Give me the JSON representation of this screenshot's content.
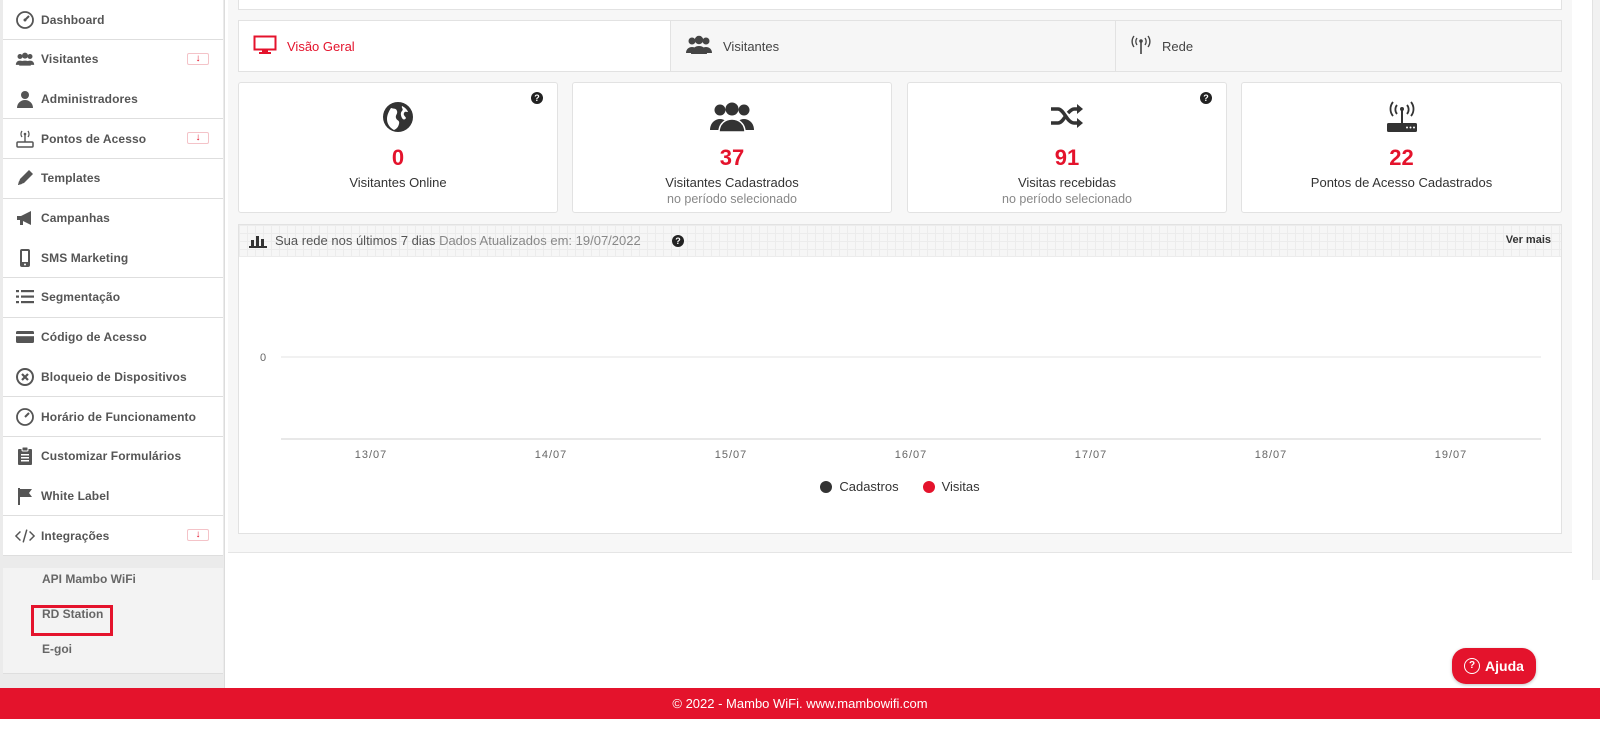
{
  "sidebar": {
    "items": [
      {
        "label": "Dashboard",
        "icon": "dashboard-icon",
        "expandable": false
      },
      {
        "label": "Visitantes",
        "icon": "users-icon",
        "expandable": true
      },
      {
        "label": "Administradores",
        "icon": "user-icon",
        "expandable": false
      },
      {
        "label": "Pontos de Acesso",
        "icon": "router-icon",
        "expandable": true
      },
      {
        "label": "Templates",
        "icon": "pencil-icon",
        "expandable": false
      },
      {
        "label": "Campanhas",
        "icon": "megaphone-icon",
        "expandable": false
      },
      {
        "label": "SMS Marketing",
        "icon": "mobile-icon",
        "expandable": false
      },
      {
        "label": "Segmentação",
        "icon": "list-icon",
        "expandable": false
      },
      {
        "label": "Código de Acesso",
        "icon": "credit-card-icon",
        "expandable": false
      },
      {
        "label": "Bloqueio de Dispositivos",
        "icon": "block-icon",
        "expandable": false
      },
      {
        "label": "Horário de Funcionamento",
        "icon": "clock-icon",
        "expandable": false
      },
      {
        "label": "Customizar Formulários",
        "icon": "clipboard-icon",
        "expandable": false
      },
      {
        "label": "White Label",
        "icon": "flag-icon",
        "expandable": false
      },
      {
        "label": "Integrações",
        "icon": "code-icon",
        "expandable": true
      }
    ],
    "subitems": [
      {
        "label": "API Mambo WiFi"
      },
      {
        "label": "RD Station",
        "active": true
      },
      {
        "label": "E-goi"
      }
    ]
  },
  "tabs": [
    {
      "label": "Visão Geral",
      "icon": "monitor-icon",
      "active": true
    },
    {
      "label": "Visitantes",
      "icon": "users-icon"
    },
    {
      "label": "Rede",
      "icon": "antenna-icon"
    }
  ],
  "cards": [
    {
      "value": "0",
      "label": "Visitantes Online",
      "sub": "",
      "icon": "globe-icon",
      "help": "?"
    },
    {
      "value": "37",
      "label": "Visitantes Cadastrados",
      "sub": "no período selecionado",
      "icon": "users-icon"
    },
    {
      "value": "91",
      "label": "Visitas recebidas",
      "sub": "no período selecionado",
      "icon": "shuffle-icon",
      "help": "?"
    },
    {
      "value": "22",
      "label": "Pontos de Acesso Cadastrados",
      "sub": "",
      "icon": "router-icon"
    }
  ],
  "chart_panel": {
    "title": "Sua rede nos últimos 7 dias",
    "updated": "Dados Atualizados em: 19/07/2022",
    "help": "?",
    "more": "Ver mais"
  },
  "chart_data": {
    "type": "line",
    "x": [
      "13/07",
      "14/07",
      "15/07",
      "16/07",
      "17/07",
      "18/07",
      "19/07"
    ],
    "y_ticks": [
      "0"
    ],
    "series": [
      {
        "name": "Cadastros",
        "color": "#333333",
        "values": [
          0,
          0,
          0,
          0,
          0,
          0,
          0
        ]
      },
      {
        "name": "Visitas",
        "color": "#e4132c",
        "values": [
          0,
          0,
          0,
          0,
          0,
          0,
          0
        ]
      }
    ]
  },
  "help_button": {
    "label": "Ajuda",
    "q": "?"
  },
  "footer": {
    "text": "© 2022 - Mambo WiFi. www.mambowifi.com"
  },
  "colors": {
    "accent": "#e4132c",
    "text": "#333333"
  }
}
